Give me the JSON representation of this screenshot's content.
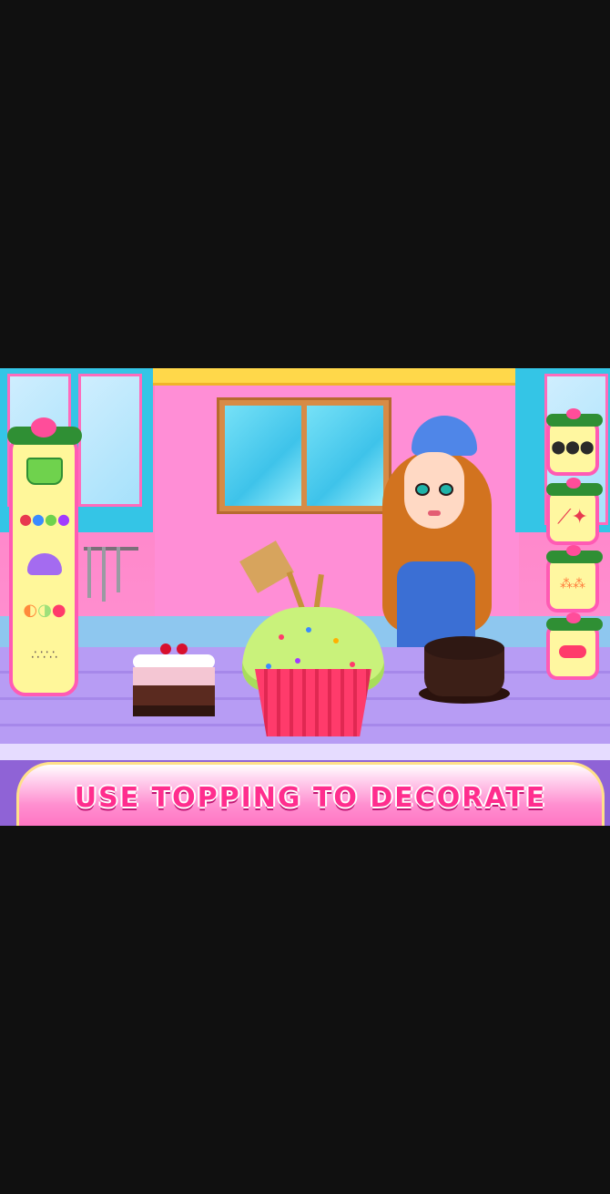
{
  "scene": {
    "banner_text": "USE TOPPING TO DECORATE"
  },
  "left_panel": {
    "items": [
      {
        "name": "cupcake-liner",
        "icon": "cupcake-liner-icon"
      },
      {
        "name": "candy-balls",
        "icon": "candy-balls-icon"
      },
      {
        "name": "purple-cream",
        "icon": "cream-icon"
      },
      {
        "name": "fruit-slices",
        "icon": "fruit-icon"
      },
      {
        "name": "sprinkles",
        "icon": "sprinkles-icon"
      }
    ]
  },
  "right_panel": {
    "items": [
      {
        "name": "chocolate-chips",
        "icon": "chips-icon"
      },
      {
        "name": "candy-sticks",
        "icon": "candy-stick-icon"
      },
      {
        "name": "rainbow-sprinkles",
        "icon": "rainbow-sprinkles-icon"
      },
      {
        "name": "jelly",
        "icon": "jelly-icon"
      }
    ]
  },
  "colors": {
    "banner_text": "#ff2e8e",
    "panel_border": "#ff5bb4",
    "panel_fill": "#fff79a"
  }
}
